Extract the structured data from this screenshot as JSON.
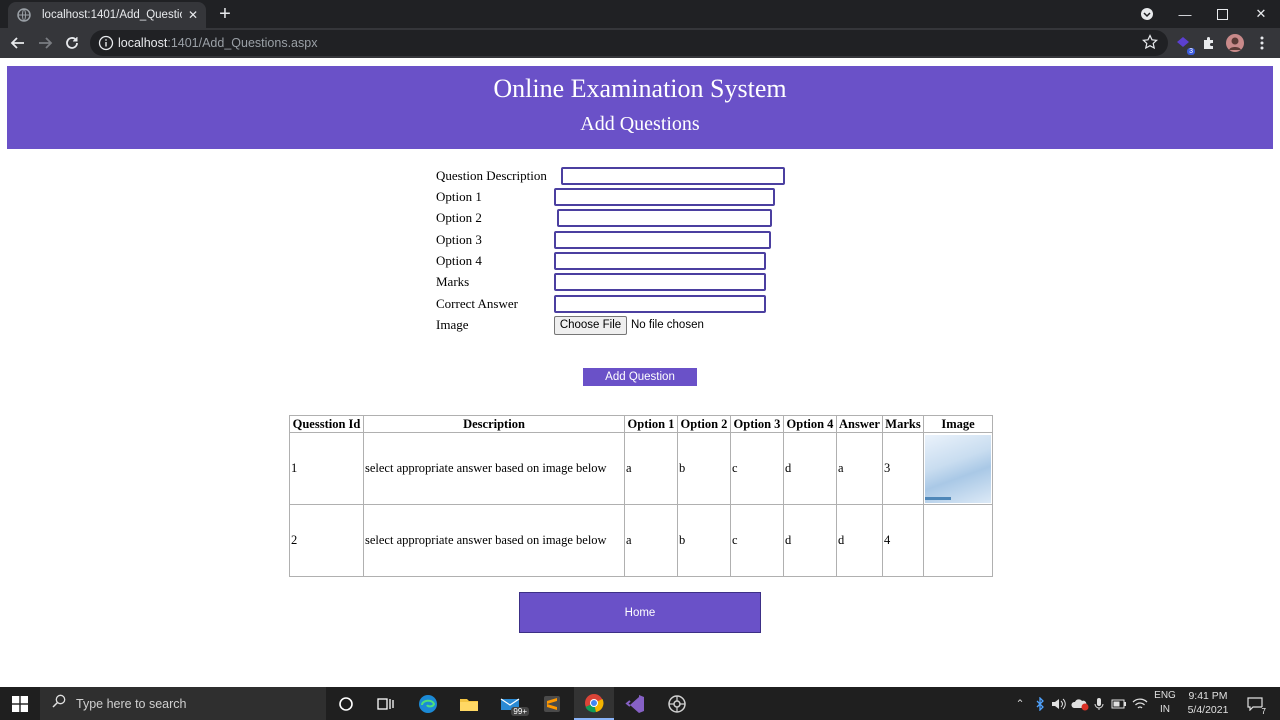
{
  "browser": {
    "tab_title": "localhost:1401/Add_Questions.aspx",
    "url_host": "localhost",
    "url_path": ":1401/Add_Questions.aspx",
    "extension_badge": "3"
  },
  "header": {
    "title": "Online Examination System",
    "subtitle": "Add Questions"
  },
  "form": {
    "labels": {
      "description": "Question Description",
      "option1": "Option 1",
      "option2": "Option 2",
      "option3": "Option 3",
      "option4": "Option 4",
      "marks": "Marks",
      "correct": "Correct Answer",
      "image": "Image"
    },
    "file_button": "Choose File",
    "file_status": "No file chosen",
    "submit_label": "Add Question"
  },
  "table": {
    "headers": [
      "Quesstion Id",
      "Description",
      "Option 1",
      "Option 2",
      "Option 3",
      "Option 4",
      "Answer",
      "Marks",
      "Image"
    ],
    "rows": [
      {
        "id": "1",
        "description": "select appropriate answer based on image below",
        "opt1": "a",
        "opt2": "b",
        "opt3": "c",
        "opt4": "d",
        "answer": "a",
        "marks": "3",
        "has_image": true
      },
      {
        "id": "2",
        "description": "select appropriate answer based on image below",
        "opt1": "a",
        "opt2": "b",
        "opt3": "c",
        "opt4": "d",
        "answer": "d",
        "marks": "4",
        "has_image": false
      }
    ]
  },
  "home_label": "Home",
  "taskbar": {
    "search_placeholder": "Type here to search",
    "mail_badge": "99+",
    "lang_line1": "ENG",
    "lang_line2": "IN",
    "time": "9:41 PM",
    "date": "5/4/2021",
    "notification_count": "7"
  },
  "colors": {
    "accent": "#6a51c8",
    "chrome_dark": "#202124",
    "chrome_mid": "#35363a"
  }
}
